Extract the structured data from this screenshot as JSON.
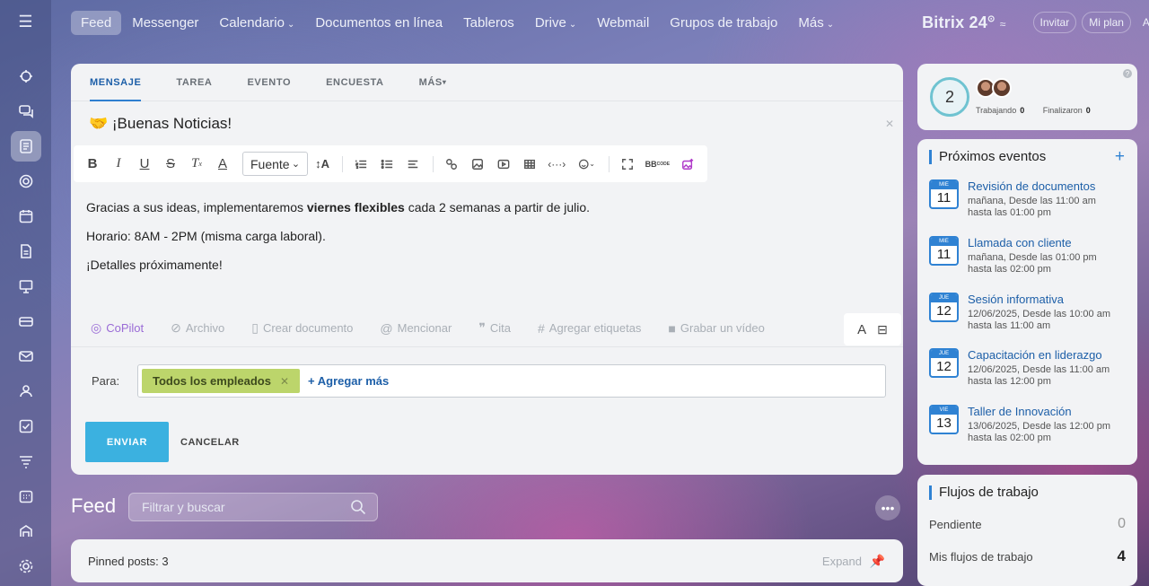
{
  "nav": {
    "items": [
      {
        "label": "Feed",
        "caret": false,
        "active": true
      },
      {
        "label": "Messenger",
        "caret": false
      },
      {
        "label": "Calendario",
        "caret": true
      },
      {
        "label": "Documentos en línea",
        "caret": false
      },
      {
        "label": "Tableros",
        "caret": false
      },
      {
        "label": "Drive",
        "caret": true
      },
      {
        "label": "Webmail",
        "caret": false
      },
      {
        "label": "Grupos de trabajo",
        "caret": false
      },
      {
        "label": "Más",
        "caret": true
      }
    ],
    "brand": "Bitrix 24",
    "invite": "Invitar",
    "plan": "Mi plan",
    "help": "Ayuda"
  },
  "composer": {
    "tabs": [
      "MENSAJE",
      "TAREA",
      "EVENTO",
      "ENCUESTA",
      "MÁS"
    ],
    "title": "🤝 ¡Buenas Noticias!",
    "font_select": "Fuente",
    "body_line1_pre": "Gracias a sus ideas, implementaremos ",
    "body_line1_bold": "viernes flexibles",
    "body_line1_post": " cada 2 semanas a partir de julio.",
    "body_line2": "Horario: 8AM - 2PM (misma carga laboral).",
    "body_line3": "¡Detalles próximamente!",
    "attachments": [
      "CoPilot",
      "Archivo",
      "Crear documento",
      "Mencionar",
      "Cita",
      "Agregar etiquetas",
      "Grabar un vídeo"
    ],
    "to_label": "Para:",
    "recipient_chip": "Todos los empleados",
    "add_more": "+ Agregar más",
    "send": "ENVIAR",
    "cancel": "CANCELAR"
  },
  "feed": {
    "title": "Feed",
    "search_placeholder": "Filtrar y buscar",
    "pinned": "Pinned posts: 3",
    "expand": "Expand"
  },
  "worktime": {
    "count": "2",
    "working_label": "Trabajando",
    "working_value": "0",
    "finished_label": "Finalizaron",
    "finished_value": "0"
  },
  "events": {
    "title": "Próximos eventos",
    "items": [
      {
        "dow": "MIÉ",
        "day": "11",
        "title": "Revisión de documentos",
        "sub1": "mañana, Desde las 11:00 am",
        "sub2": "hasta las 01:00 pm"
      },
      {
        "dow": "MIÉ",
        "day": "11",
        "title": "Llamada con cliente",
        "sub1": "mañana, Desde las 01:00 pm",
        "sub2": "hasta las 02:00 pm"
      },
      {
        "dow": "JUE",
        "day": "12",
        "title": "Sesión informativa",
        "sub1": "12/06/2025, Desde las 10:00 am",
        "sub2": "hasta las 11:00 am"
      },
      {
        "dow": "JUE",
        "day": "12",
        "title": "Capacitación en liderazgo",
        "sub1": "12/06/2025, Desde las 11:00 am",
        "sub2": "hasta las 12:00 pm"
      },
      {
        "dow": "VIE",
        "day": "13",
        "title": "Taller de Innovación",
        "sub1": "13/06/2025, Desde las 12:00 pm",
        "sub2": "hasta las 02:00 pm"
      }
    ]
  },
  "workflows": {
    "title": "Flujos de trabajo",
    "pending_label": "Pendiente",
    "pending_value": "0",
    "mine_label": "Mis flujos de trabajo",
    "mine_value": "4"
  }
}
